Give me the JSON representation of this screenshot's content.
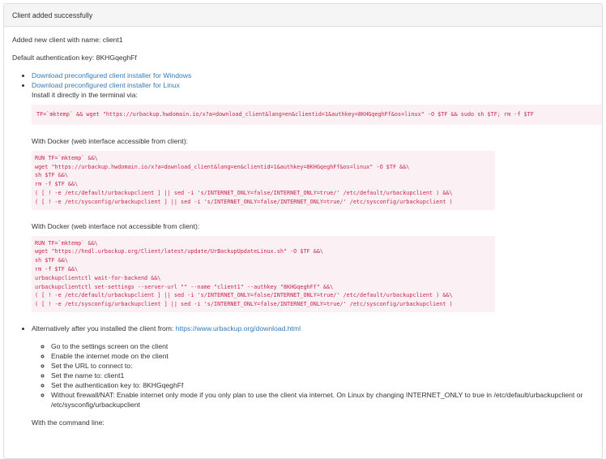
{
  "panel": {
    "title": "Client added successfully"
  },
  "body": {
    "added_line": "Added new client with name: client1",
    "authkey_line": "Default authentication key: 8KHGqeghFf",
    "downloads": [
      {
        "label": "Download preconfigured client installer for Windows"
      },
      {
        "label": "Download preconfigured client installer for Linux"
      }
    ],
    "terminal_label": "Install it directly in the terminal via:",
    "terminal_cmd": "TF=`mktemp` && wget \"https://urbackup.hwdomain.io/x?a=download_client&lang=en&clientid=1&authkey=8KHGqeghFf&os=linux\" -O $TF && sudo sh $TF; rm -f $TF",
    "docker1_label": "With Docker (web interface accessible from client):",
    "docker1_cmd": "RUN TF=`mktemp` &&\\\nwget \"https://urbackup.hwdomain.io/x?a=download_client&lang=en&clientid=1&authkey=8KHGqeghFf&os=linux\" -O $TF &&\\\nsh $TF &&\\\nrm -f $TF &&\\\n( [ ! -e /etc/default/urbackupclient ] || sed -i 's/INTERNET_ONLY=false/INTERNET_ONLY=true/' /etc/default/urbackupclient ) &&\\\n( [ ! -e /etc/sysconfig/urbackupclient ] || sed -i 's/INTERNET_ONLY=false/INTERNET_ONLY=true/' /etc/sysconfig/urbackupclient )",
    "docker2_label": "With Docker (web interface not accessible from client):",
    "docker2_cmd": "RUN TF=`mktemp` &&\\\nwget \"https://hndl.urbackup.org/Client/latest/update/UrBackupUpdateLinux.sh\" -O $TF &&\\\nsh $TF &&\\\nrm -f $TF &&\\\nurbackupclientctl wait-for-backend &&\\\nurbackupclientctl set-settings --server-url \"\" --name \"client1\" --authkey \"8KHGqeghFf\" &&\\\n( [ ! -e /etc/default/urbackupclient ] || sed -i 's/INTERNET_ONLY=false/INTERNET_ONLY=true/' /etc/default/urbackupclient ) &&\\\n( [ ! -e /etc/sysconfig/urbackupclient ] || sed -i 's/INTERNET_ONLY=false/INTERNET_ONLY=true/' /etc/sysconfig/urbackupclient )",
    "alt_prefix": "Alternatively after you installed the client from: ",
    "alt_link": "https://www.urbackup.org/download.html",
    "steps": [
      "Go to the settings screen on the client",
      "Enable the internet mode on the client",
      "Set the URL to connect to:",
      "Set the name to: client1",
      "Set the authentication key to: 8KHGqeghFf",
      "Without firewall/NAT: Enable internet only mode if you only plan to use the client via internet. On Linux by changing INTERNET_ONLY to true in /etc/default/urbackupclient or /etc/sysconfig/urbackupclient"
    ],
    "cmdline_label": "With the command line:"
  },
  "colors": {
    "link": "#337ab7",
    "code_text": "#c7254e",
    "code_bg": "#fbf1f4",
    "heading_bg": "#f5f5f5",
    "border": "#dddddd"
  }
}
